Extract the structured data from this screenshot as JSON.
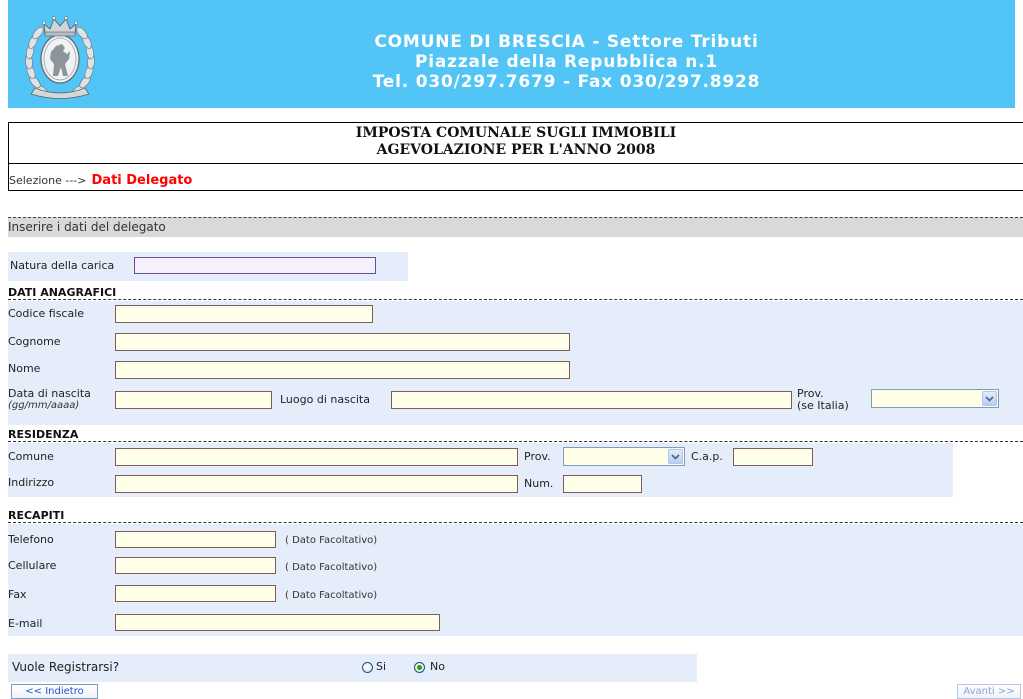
{
  "header": {
    "logo_icon": "coat-of-arms",
    "lines": [
      "COMUNE DI BRESCIA - Settore Tributi",
      "Piazzale della Repubblica n.1",
      "Tel. 030/297.7679 - Fax 030/297.8928"
    ]
  },
  "title": {
    "line1": "IMPOSTA COMUNALE SUGLI IMMOBILI",
    "line2": "AGEVOLAZIONE PER L'ANNO 2008"
  },
  "breadcrumb": {
    "step1": "Selezione --->",
    "current": "Dati Delegato"
  },
  "instructions": "Inserire i dati del delegato",
  "natura": {
    "label": "Natura della carica",
    "value": ""
  },
  "anagrafici": {
    "heading": "DATI ANAGRAFICI",
    "codice_fiscale": {
      "label": "Codice fiscale",
      "value": ""
    },
    "cognome": {
      "label": "Cognome",
      "value": ""
    },
    "nome": {
      "label": "Nome",
      "value": ""
    },
    "data_nascita": {
      "label": "Data di nascita",
      "hint": "(gg/mm/aaaa)",
      "value": ""
    },
    "luogo_nascita": {
      "label": "Luogo di nascita",
      "value": ""
    },
    "prov_nascita": {
      "label": "Prov.",
      "hint": "(se Italia)",
      "selected": "",
      "icon": "chevron-down-icon"
    }
  },
  "residenza": {
    "heading": "RESIDENZA",
    "comune": {
      "label": "Comune",
      "value": ""
    },
    "prov": {
      "label": "Prov.",
      "selected": "",
      "icon": "chevron-down-icon"
    },
    "cap": {
      "label": "C.a.p.",
      "value": ""
    },
    "indirizzo": {
      "label": "Indirizzo",
      "value": ""
    },
    "num": {
      "label": "Num.",
      "value": ""
    }
  },
  "recapiti": {
    "heading": "RECAPITI",
    "telefono": {
      "label": "Telefono",
      "note": "( Dato Facoltativo)",
      "value": ""
    },
    "cellulare": {
      "label": "Cellulare",
      "note": "( Dato Facoltativo)",
      "value": ""
    },
    "fax": {
      "label": "Fax",
      "note": "( Dato Facoltativo)",
      "value": ""
    },
    "email": {
      "label": "E-mail",
      "value": ""
    }
  },
  "registrazione": {
    "question": "Vuole Registrarsi?",
    "options": [
      {
        "label": "Si",
        "checked": false
      },
      {
        "label": "No",
        "checked": true
      }
    ]
  },
  "nav": {
    "back": "<< Indietro",
    "next": "Avanti >>"
  },
  "colors": {
    "header_bg": "#52c4f5",
    "header_text": "#ffffff",
    "panel_bg": "#e5edfa",
    "band_bg": "#d9d9d9",
    "input_bg": "#ffffe9",
    "active_step": "#ff0000",
    "button_text": "#2255cc"
  }
}
